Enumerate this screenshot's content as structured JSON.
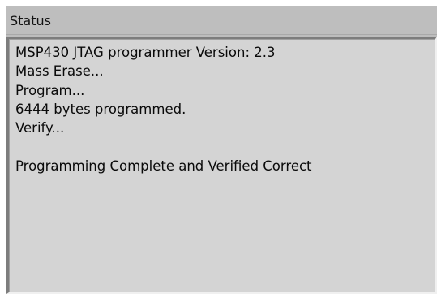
{
  "panel": {
    "title": "Status"
  },
  "log": {
    "lines": [
      "MSP430 JTAG programmer Version: 2.3",
      "Mass Erase...",
      "Program...",
      "6444 bytes programmed.",
      "Verify...",
      "",
      "Programming Complete and Verified Correct"
    ]
  }
}
